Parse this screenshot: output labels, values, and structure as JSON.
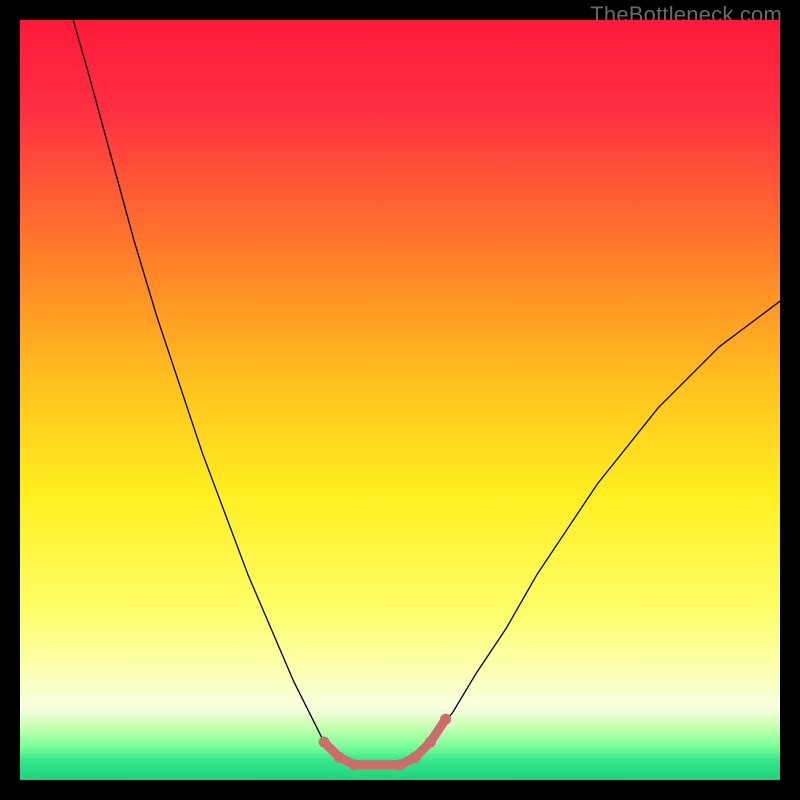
{
  "watermark": "TheBottleneck.com",
  "chart_data": {
    "type": "line",
    "title": "",
    "xlabel": "",
    "ylabel": "",
    "xlim": [
      0,
      100
    ],
    "ylim": [
      0,
      100
    ],
    "background_gradient": {
      "stops": [
        {
          "offset": 0.0,
          "color": "#ff1a3a"
        },
        {
          "offset": 0.12,
          "color": "#ff2f43"
        },
        {
          "offset": 0.3,
          "color": "#ff7a2a"
        },
        {
          "offset": 0.48,
          "color": "#ffc21e"
        },
        {
          "offset": 0.62,
          "color": "#ffee1f"
        },
        {
          "offset": 0.78,
          "color": "#fdff6a"
        },
        {
          "offset": 0.86,
          "color": "#fbffb5"
        },
        {
          "offset": 0.905,
          "color": "#f7ffe0"
        },
        {
          "offset": 0.93,
          "color": "#c8ffb0"
        },
        {
          "offset": 0.955,
          "color": "#7dff9a"
        },
        {
          "offset": 0.975,
          "color": "#34e68a"
        },
        {
          "offset": 1.0,
          "color": "#1fd47f"
        }
      ]
    },
    "series": [
      {
        "name": "bottleneck-curve",
        "stroke": "#000000",
        "stroke_width": 1.3,
        "points": [
          {
            "x": 7,
            "y": 100
          },
          {
            "x": 9,
            "y": 93
          },
          {
            "x": 12,
            "y": 82
          },
          {
            "x": 15,
            "y": 71
          },
          {
            "x": 18,
            "y": 61
          },
          {
            "x": 21,
            "y": 52
          },
          {
            "x": 24,
            "y": 43
          },
          {
            "x": 27,
            "y": 35
          },
          {
            "x": 30,
            "y": 27
          },
          {
            "x": 33,
            "y": 20
          },
          {
            "x": 36,
            "y": 13
          },
          {
            "x": 38,
            "y": 9
          },
          {
            "x": 40,
            "y": 5
          },
          {
            "x": 42,
            "y": 3
          },
          {
            "x": 44,
            "y": 2
          },
          {
            "x": 46,
            "y": 2
          },
          {
            "x": 48,
            "y": 2
          },
          {
            "x": 50,
            "y": 2
          },
          {
            "x": 52,
            "y": 3
          },
          {
            "x": 54,
            "y": 5
          },
          {
            "x": 57,
            "y": 9
          },
          {
            "x": 60,
            "y": 14
          },
          {
            "x": 64,
            "y": 20
          },
          {
            "x": 68,
            "y": 27
          },
          {
            "x": 72,
            "y": 33
          },
          {
            "x": 76,
            "y": 39
          },
          {
            "x": 80,
            "y": 44
          },
          {
            "x": 84,
            "y": 49
          },
          {
            "x": 88,
            "y": 53
          },
          {
            "x": 92,
            "y": 57
          },
          {
            "x": 96,
            "y": 60
          },
          {
            "x": 100,
            "y": 63
          }
        ]
      },
      {
        "name": "highlight-segment",
        "stroke": "#ce6b6b",
        "stroke_width": 9,
        "linecap": "round",
        "points": [
          {
            "x": 40,
            "y": 5
          },
          {
            "x": 42,
            "y": 3
          },
          {
            "x": 44,
            "y": 2
          },
          {
            "x": 46,
            "y": 2
          },
          {
            "x": 48,
            "y": 2
          },
          {
            "x": 50,
            "y": 2
          },
          {
            "x": 52,
            "y": 3
          },
          {
            "x": 54,
            "y": 5
          },
          {
            "x": 56,
            "y": 8
          }
        ]
      }
    ],
    "highlight_dots": {
      "color": "#ce6b6b",
      "radius": 5.5,
      "points": [
        {
          "x": 40,
          "y": 5
        },
        {
          "x": 42,
          "y": 3
        },
        {
          "x": 44,
          "y": 2
        },
        {
          "x": 50,
          "y": 2
        },
        {
          "x": 52,
          "y": 3
        },
        {
          "x": 54,
          "y": 5
        },
        {
          "x": 56,
          "y": 8
        }
      ]
    }
  }
}
